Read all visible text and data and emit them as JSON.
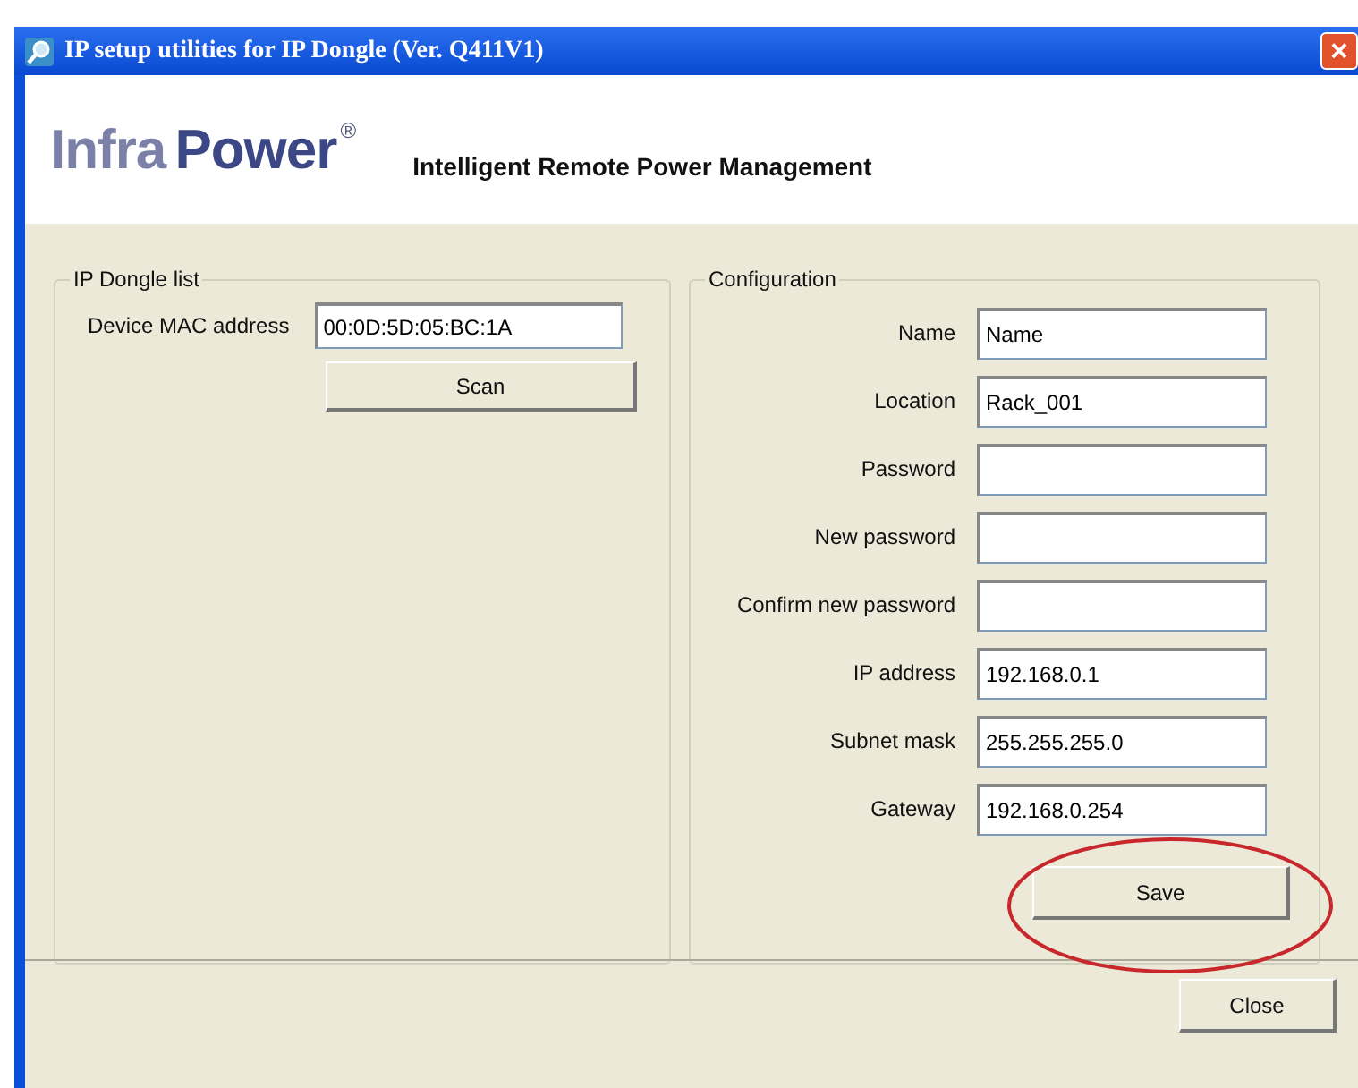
{
  "window": {
    "title": "IP setup utilities for IP Dongle (Ver. Q411V1)",
    "close_button": "×"
  },
  "header": {
    "logo": {
      "part_1": "Infra",
      "part_2": "Power",
      "mark": "®"
    },
    "tagline": "Intelligent Remote Power Management"
  },
  "dongle_list": {
    "title": "IP Dongle list",
    "label": "Device MAC address",
    "value": "00:0D:5D:05:BC:1A",
    "button": "Scan"
  },
  "configuration": {
    "title": "Configuration",
    "fields": [
      {
        "label": "Name",
        "value": "Name"
      },
      {
        "label": "Location",
        "value": "Rack_001"
      },
      {
        "label": "Password"
      },
      {
        "label": "New password"
      },
      {
        "label": "Confirm new password"
      },
      {
        "label": "IP address",
        "value": "192.168.0.1"
      },
      {
        "label": "Subnet mask",
        "value": "255.255.255.0"
      },
      {
        "label": "Gateway",
        "value": "192.168.0.254"
      }
    ],
    "button": "Save",
    "highlighted": true
  },
  "footer": {
    "button": "Close"
  }
}
